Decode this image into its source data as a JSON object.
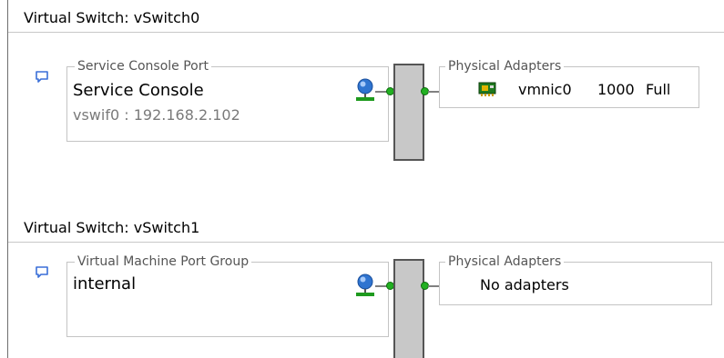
{
  "switches": [
    {
      "title": "Virtual Switch: vSwitch0",
      "port": {
        "legend": "Service Console Port",
        "name": "Service Console",
        "detail": "vswif0 : 192.168.2.102"
      },
      "adapters": {
        "legend": "Physical Adapters",
        "nic": {
          "name": "vmnic0",
          "speed": "1000",
          "duplex": "Full"
        }
      }
    },
    {
      "title": "Virtual Switch: vSwitch1",
      "port": {
        "legend": "Virtual Machine Port Group",
        "name": "internal"
      },
      "adapters": {
        "legend": "Physical Adapters",
        "empty": "No adapters"
      }
    }
  ],
  "icons": {
    "note": "speech-bubble-icon",
    "port": "network-globe-icon",
    "nic": "network-card-icon"
  },
  "colors": {
    "connector_green": "#22b022",
    "note_blue": "#3a6fd8",
    "switch_fill": "#c8c8c8"
  }
}
